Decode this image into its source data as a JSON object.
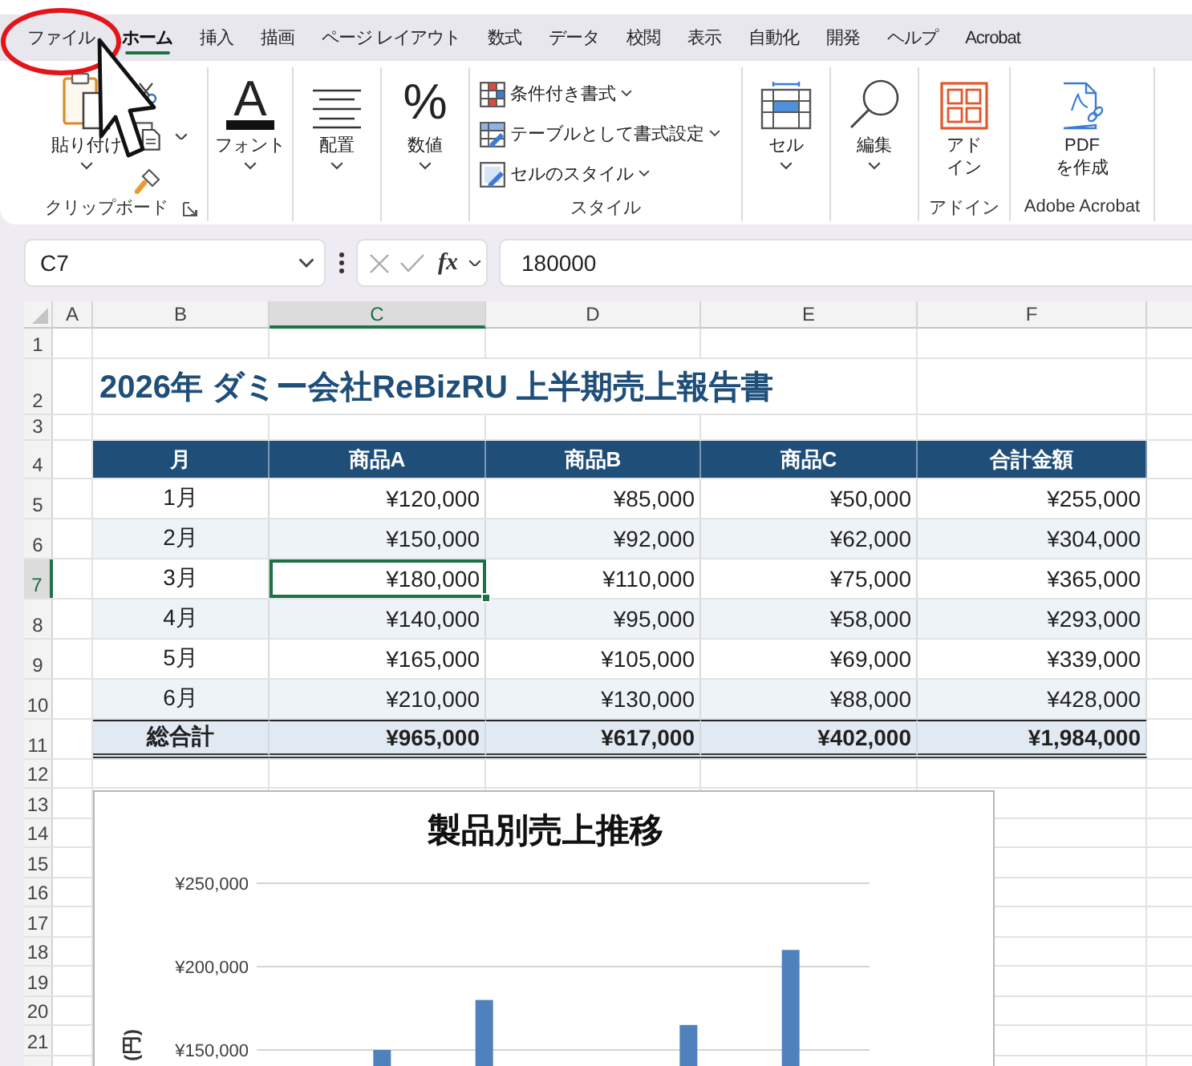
{
  "ribbon": {
    "tabs": [
      {
        "label": "ファイル",
        "selected": false
      },
      {
        "label": "ホーム",
        "selected": true
      },
      {
        "label": "挿入",
        "selected": false
      },
      {
        "label": "描画",
        "selected": false
      },
      {
        "label": "ページ レイアウト",
        "selected": false
      },
      {
        "label": "数式",
        "selected": false
      },
      {
        "label": "データ",
        "selected": false
      },
      {
        "label": "校閲",
        "selected": false
      },
      {
        "label": "表示",
        "selected": false
      },
      {
        "label": "自動化",
        "selected": false
      },
      {
        "label": "開発",
        "selected": false
      },
      {
        "label": "ヘルプ",
        "selected": false
      },
      {
        "label": "Acrobat",
        "selected": false
      }
    ],
    "groups": [
      {
        "kind": "clipboard",
        "label": "クリップボード",
        "button": {
          "label": "貼り付け",
          "dropdown": true
        }
      },
      {
        "kind": "font",
        "button": {
          "glyph": "A",
          "label": "フォント",
          "dropdown": true
        }
      },
      {
        "kind": "alignment",
        "button": {
          "label": "配置",
          "dropdown": true
        }
      },
      {
        "kind": "number",
        "button": {
          "glyph": "%",
          "label": "数値",
          "dropdown": true
        }
      },
      {
        "kind": "styles",
        "label": "スタイル",
        "items": [
          {
            "label": "条件付き書式",
            "dropdown": true
          },
          {
            "label": "テーブルとして書式設定",
            "dropdown": true
          },
          {
            "label": "セルのスタイル",
            "dropdown": true
          }
        ]
      },
      {
        "kind": "cells",
        "button": {
          "label": "セル",
          "dropdown": true
        }
      },
      {
        "kind": "editing",
        "button": {
          "label": "編集",
          "dropdown": true
        }
      },
      {
        "kind": "addins",
        "label": "アドイン",
        "button": {
          "label": "アドイン",
          "dropdown": false
        }
      },
      {
        "kind": "acrobat",
        "label": "Adobe Acrobat",
        "button": {
          "label": "PDF\nを作成",
          "dropdown": false
        }
      }
    ]
  },
  "formula_bar": {
    "name_box": "C7",
    "function_button": "fx",
    "formula": "180000"
  },
  "sheet": {
    "columns": [
      {
        "label": "A",
        "selected": false
      },
      {
        "label": "B",
        "selected": false
      },
      {
        "label": "C",
        "selected": true
      },
      {
        "label": "D",
        "selected": false
      },
      {
        "label": "E",
        "selected": false
      },
      {
        "label": "F",
        "selected": false
      }
    ],
    "rows": [
      {
        "label": "1",
        "selected": false
      },
      {
        "label": "2",
        "selected": false
      },
      {
        "label": "3",
        "selected": false
      },
      {
        "label": "4",
        "selected": false
      },
      {
        "label": "5",
        "selected": false
      },
      {
        "label": "6",
        "selected": false
      },
      {
        "label": "7",
        "selected": true
      },
      {
        "label": "8",
        "selected": false
      },
      {
        "label": "9",
        "selected": false
      },
      {
        "label": "10",
        "selected": false
      },
      {
        "label": "11",
        "selected": false
      },
      {
        "label": "12",
        "selected": false
      },
      {
        "label": "13",
        "selected": false
      },
      {
        "label": "14",
        "selected": false
      },
      {
        "label": "15",
        "selected": false
      },
      {
        "label": "16",
        "selected": false
      },
      {
        "label": "17",
        "selected": false
      },
      {
        "label": "18",
        "selected": false
      },
      {
        "label": "19",
        "selected": false
      },
      {
        "label": "20",
        "selected": false
      },
      {
        "label": "21",
        "selected": false
      }
    ]
  },
  "report": {
    "title": "2026年 ダミー会社ReBizRU 上半期売上報告書",
    "table": {
      "columns": [
        "月",
        "商品A",
        "商品B",
        "商品C",
        "合計金額"
      ],
      "rows": [
        {
          "cells": [
            {
              "text": "1月",
              "selected": false
            },
            {
              "text": "¥120,000",
              "selected": false
            },
            {
              "text": "¥85,000",
              "selected": false
            },
            {
              "text": "¥50,000",
              "selected": false
            },
            {
              "text": "¥255,000",
              "selected": false
            }
          ]
        },
        {
          "cells": [
            {
              "text": "2月",
              "selected": false
            },
            {
              "text": "¥150,000",
              "selected": false
            },
            {
              "text": "¥92,000",
              "selected": false
            },
            {
              "text": "¥62,000",
              "selected": false
            },
            {
              "text": "¥304,000",
              "selected": false
            }
          ]
        },
        {
          "cells": [
            {
              "text": "3月",
              "selected": false
            },
            {
              "text": "¥180,000",
              "selected": true
            },
            {
              "text": "¥110,000",
              "selected": false
            },
            {
              "text": "¥75,000",
              "selected": false
            },
            {
              "text": "¥365,000",
              "selected": false
            }
          ]
        },
        {
          "cells": [
            {
              "text": "4月",
              "selected": false
            },
            {
              "text": "¥140,000",
              "selected": false
            },
            {
              "text": "¥95,000",
              "selected": false
            },
            {
              "text": "¥58,000",
              "selected": false
            },
            {
              "text": "¥293,000",
              "selected": false
            }
          ]
        },
        {
          "cells": [
            {
              "text": "5月",
              "selected": false
            },
            {
              "text": "¥165,000",
              "selected": false
            },
            {
              "text": "¥105,000",
              "selected": false
            },
            {
              "text": "¥69,000",
              "selected": false
            },
            {
              "text": "¥339,000",
              "selected": false
            }
          ]
        },
        {
          "cells": [
            {
              "text": "6月",
              "selected": false
            },
            {
              "text": "¥210,000",
              "selected": false
            },
            {
              "text": "¥130,000",
              "selected": false
            },
            {
              "text": "¥88,000",
              "selected": false
            },
            {
              "text": "¥428,000",
              "selected": false
            }
          ]
        }
      ],
      "total_row": {
        "cells": [
          {
            "text": "総合計",
            "selected": false
          },
          {
            "text": "¥965,000",
            "selected": false
          },
          {
            "text": "¥617,000",
            "selected": false
          },
          {
            "text": "¥402,000",
            "selected": false
          },
          {
            "text": "¥1,984,000",
            "selected": false
          }
        ]
      }
    }
  },
  "chart": {
    "chart_data": {
      "type": "bar",
      "title": "製品別売上推移",
      "ylabel": "(円)",
      "ylim": [
        140000,
        250000
      ],
      "yticks": [
        {
          "value": 150000,
          "label": "¥150,000"
        },
        {
          "value": 200000,
          "label": "¥200,000"
        },
        {
          "value": 250000,
          "label": "¥250,000"
        }
      ],
      "values": [
        null,
        150000,
        180000,
        null,
        165000,
        210000
      ]
    }
  }
}
